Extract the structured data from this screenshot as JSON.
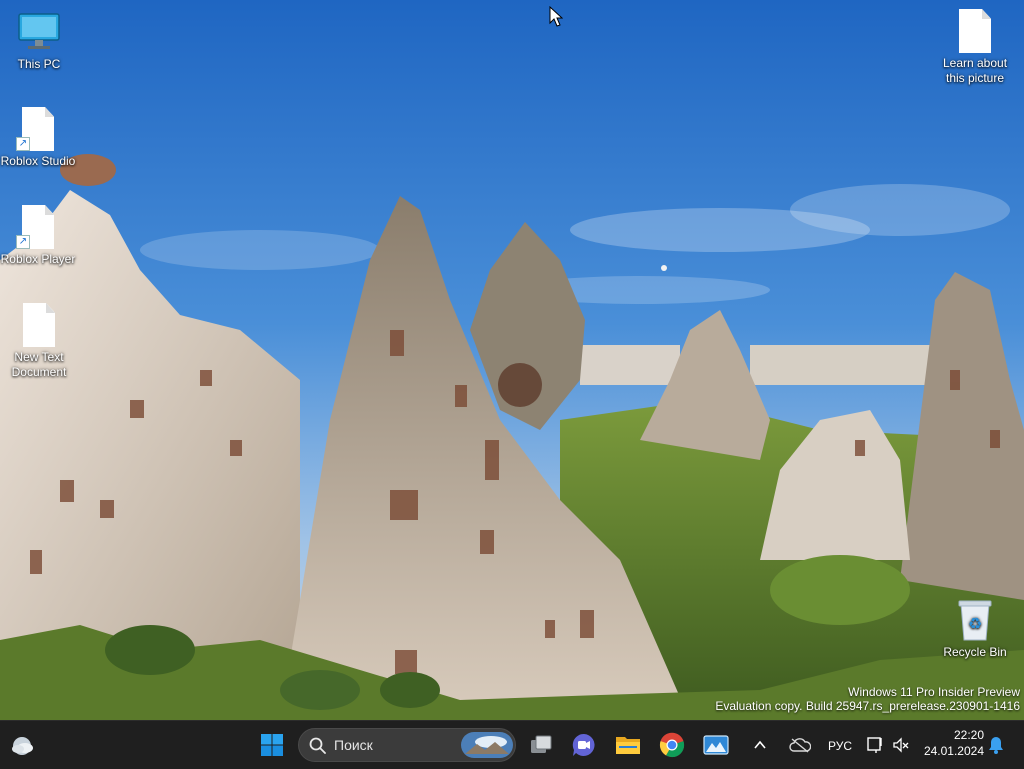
{
  "desktop": {
    "icons": [
      {
        "label": "This PC",
        "icon": "computer-icon"
      },
      {
        "label": "Roblox Studio",
        "icon": "file-shortcut-icon"
      },
      {
        "label": "Roblox Player",
        "icon": "file-shortcut-icon"
      },
      {
        "label": "New Text\nDocument",
        "icon": "text-document-icon"
      },
      {
        "label": "Learn about\nthis picture",
        "icon": "document-icon"
      },
      {
        "label": "Recycle Bin",
        "icon": "recycle-bin-icon"
      }
    ]
  },
  "watermark": {
    "line1": "Windows 11 Pro Insider Preview",
    "line2": "Evaluation copy. Build 25947.rs_prerelease.230901-1416"
  },
  "taskbar": {
    "search_placeholder": "Поиск",
    "apps": [
      "widgets-icon",
      "start-icon",
      "task-view-icon",
      "chat-icon",
      "file-explorer-icon",
      "chrome-icon",
      "photos-icon"
    ],
    "tray": {
      "language": "РУС",
      "time": "22:20",
      "date": "24.01.2024"
    }
  },
  "colors": {
    "taskbar_bg": "#1f1f1f",
    "accent": "#0078d4"
  }
}
